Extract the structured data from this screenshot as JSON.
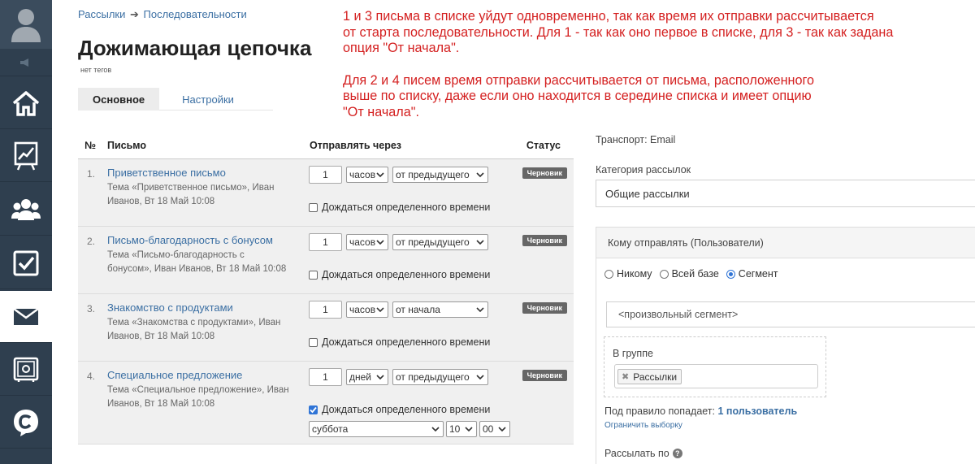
{
  "sidebar": {
    "items": [
      {
        "icon": "home-icon"
      },
      {
        "icon": "chart-board-icon"
      },
      {
        "icon": "users-icon"
      },
      {
        "icon": "tasks-check-icon"
      },
      {
        "icon": "mail-icon"
      },
      {
        "icon": "safe-icon"
      },
      {
        "icon": "chat-c-icon"
      }
    ]
  },
  "breadcrumb": {
    "root": "Рассылки",
    "separator": "➔",
    "current": "Последовательности"
  },
  "page": {
    "title": "Дожимающая цепочка",
    "tags": "нет тегов"
  },
  "annotation": {
    "paragraph1_line1": "1 и 3 письма в списке уйдут одновременно, так как время их отправки рассчитывается",
    "paragraph1_line2": "от старта последовательности. Для 1 - так как оно первое в списке, для 3 - так как задана",
    "paragraph1_line3": "опция \"От начала\".",
    "paragraph2_line1": "Для 2 и 4 писем время отправки рассчитывается от письма, расположенного",
    "paragraph2_line2": "выше по списку, даже если оно находится в середине списка и имеет опцию",
    "paragraph2_line3": "\"От начала\"."
  },
  "tabs": {
    "main": "Основное",
    "settings": "Настройки"
  },
  "table": {
    "headers": {
      "num": "№",
      "letter": "Письмо",
      "send_after": "Отправлять через",
      "status": "Статус"
    },
    "wait_label": "Дождаться определенного времени",
    "rows": [
      {
        "num": "1.",
        "title": "Приветственное письмо",
        "meta_line1": "Тема «Приветственное письмо», Иван",
        "meta_line2": "Иванов, Вт 18 Май 10:08",
        "amount": "1",
        "unit": "часов",
        "from": "от предыдущего",
        "status": "Черновик"
      },
      {
        "num": "2.",
        "title": "Письмо-благодарность с бонусом",
        "meta_line1": "Тема «Письмо-благодарность с",
        "meta_line2": "бонусом», Иван Иванов, Вт 18 Май 10:08",
        "amount": "1",
        "unit": "часов",
        "from": "от предыдущего",
        "status": "Черновик"
      },
      {
        "num": "3.",
        "title": "Знакомство с продуктами",
        "meta_line1": "Тема «Знакомства с продуктами», Иван",
        "meta_line2": "Иванов, Вт 18 Май 10:08",
        "amount": "1",
        "unit": "часов",
        "from": "от начала",
        "status": "Черновик"
      },
      {
        "num": "4.",
        "title": "Специальное предложение",
        "meta_line1": "Тема «Специальное предложение», Иван",
        "meta_line2": "Иванов, Вт 18 Май 10:08",
        "amount": "1",
        "unit": "дней",
        "from": "от предыдущего",
        "status": "Черновик",
        "wait_checked": true,
        "weekday": "суббота",
        "hour": "10",
        "minute": "00"
      }
    ]
  },
  "right": {
    "transport": "Транспорт: Email",
    "category_label": "Категория рассылок",
    "category_value": "Общие рассылки",
    "recipients_header": "Кому отправлять (Пользователи)",
    "radio_none": "Никому",
    "radio_all": "Всей базе",
    "radio_segment": "Сегмент",
    "segment_placeholder": "<произвольный сегмент>",
    "group_label": "В группе",
    "group_tag": "Рассылки",
    "rule_prefix": "Под правило попадает:",
    "rule_count": "1 пользователь",
    "limit_link": "Ограничить выборку",
    "send_by": "Рассылать по"
  },
  "colors": {
    "sidebar": "#2f3f4f",
    "link": "#3b6fa3",
    "annotation": "#d42020",
    "badge": "#666666",
    "checkbox_checked": "#2f74d6"
  }
}
